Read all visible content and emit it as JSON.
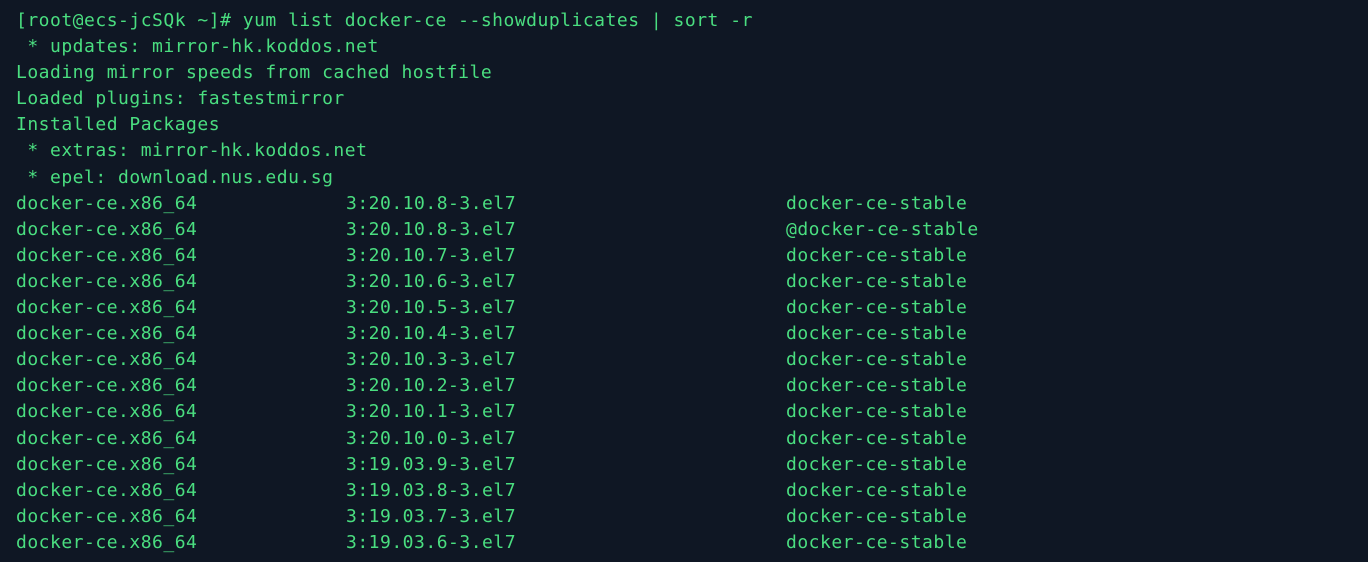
{
  "prompt": "[root@ecs-jcSQk ~]# yum list docker-ce --showduplicates | sort -r",
  "lines": [
    " * updates: mirror-hk.koddos.net",
    "Loading mirror speeds from cached hostfile",
    "Loaded plugins: fastestmirror",
    "Installed Packages",
    " * extras: mirror-hk.koddos.net",
    " * epel: download.nus.edu.sg"
  ],
  "packages": [
    {
      "name": "docker-ce.x86_64",
      "version": "3:20.10.8-3.el7",
      "repo": "docker-ce-stable"
    },
    {
      "name": "docker-ce.x86_64",
      "version": "3:20.10.8-3.el7",
      "repo": "@docker-ce-stable"
    },
    {
      "name": "docker-ce.x86_64",
      "version": "3:20.10.7-3.el7",
      "repo": "docker-ce-stable"
    },
    {
      "name": "docker-ce.x86_64",
      "version": "3:20.10.6-3.el7",
      "repo": "docker-ce-stable"
    },
    {
      "name": "docker-ce.x86_64",
      "version": "3:20.10.5-3.el7",
      "repo": "docker-ce-stable"
    },
    {
      "name": "docker-ce.x86_64",
      "version": "3:20.10.4-3.el7",
      "repo": "docker-ce-stable"
    },
    {
      "name": "docker-ce.x86_64",
      "version": "3:20.10.3-3.el7",
      "repo": "docker-ce-stable"
    },
    {
      "name": "docker-ce.x86_64",
      "version": "3:20.10.2-3.el7",
      "repo": "docker-ce-stable"
    },
    {
      "name": "docker-ce.x86_64",
      "version": "3:20.10.1-3.el7",
      "repo": "docker-ce-stable"
    },
    {
      "name": "docker-ce.x86_64",
      "version": "3:20.10.0-3.el7",
      "repo": "docker-ce-stable"
    },
    {
      "name": "docker-ce.x86_64",
      "version": "3:19.03.9-3.el7",
      "repo": "docker-ce-stable"
    },
    {
      "name": "docker-ce.x86_64",
      "version": "3:19.03.8-3.el7",
      "repo": "docker-ce-stable"
    },
    {
      "name": "docker-ce.x86_64",
      "version": "3:19.03.7-3.el7",
      "repo": "docker-ce-stable"
    },
    {
      "name": "docker-ce.x86_64",
      "version": "3:19.03.6-3.el7",
      "repo": "docker-ce-stable"
    }
  ]
}
